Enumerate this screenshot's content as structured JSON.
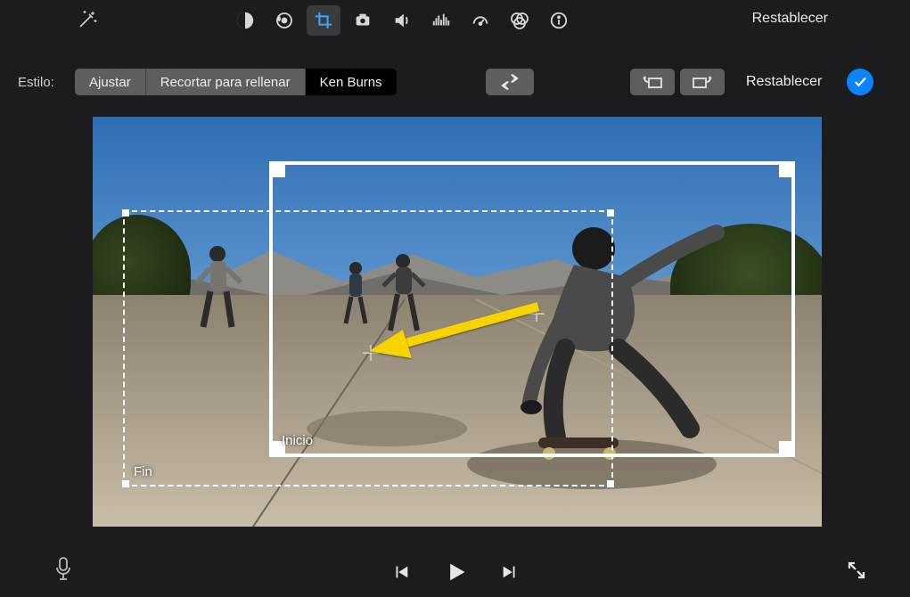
{
  "topbar": {
    "reset_label": "Restablecer"
  },
  "options": {
    "style_label": "Estilo:",
    "fit_label": "Ajustar",
    "crop_label": "Recortar para rellenar",
    "kenburns_label": "Ken Burns",
    "reset_label": "Restablecer"
  },
  "kenburns": {
    "start_label": "Inicio",
    "end_label": "Fin"
  },
  "tool_icons": [
    "adjust",
    "color-palette",
    "crop",
    "camera",
    "volume",
    "audio-levels",
    "speed",
    "filters",
    "info"
  ]
}
